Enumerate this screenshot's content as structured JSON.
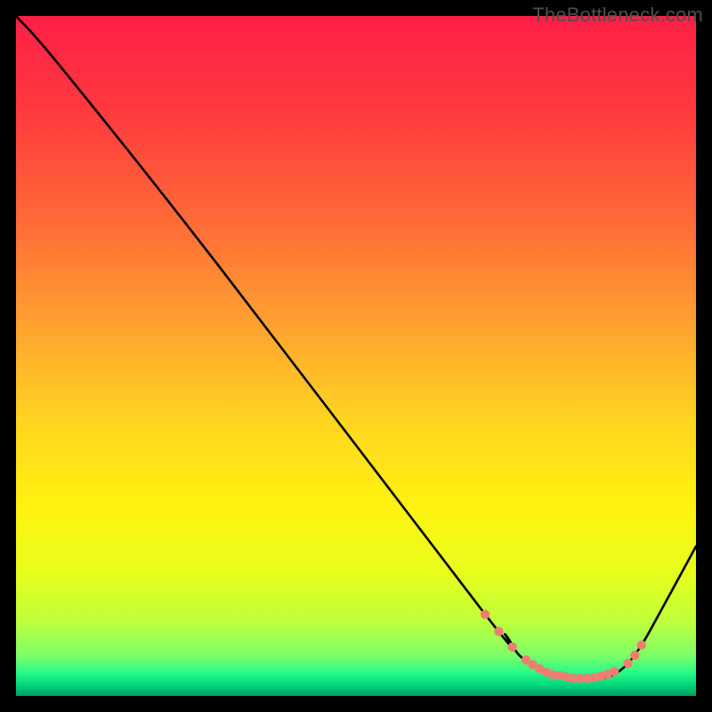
{
  "watermark": "TheBottleneck.com",
  "chart_data": {
    "type": "line",
    "title": "",
    "xlabel": "",
    "ylabel": "",
    "xlim": [
      0,
      100
    ],
    "ylim": [
      0,
      100
    ],
    "grid": false,
    "series": [
      {
        "name": "curve",
        "x": [
          0,
          7,
          30,
          69,
          72,
          74,
          77,
          80,
          82,
          84,
          86,
          88,
          90,
          92,
          94,
          100
        ],
        "y": [
          100,
          92,
          63,
          12,
          9,
          6,
          4,
          3,
          2.5,
          2.5,
          2.6,
          3.2,
          4.8,
          7.5,
          11,
          22
        ]
      }
    ],
    "markers": {
      "name": "highlight-points",
      "color": "#ef7e72",
      "x": [
        69,
        71,
        73,
        75,
        76,
        77,
        78,
        79,
        80,
        81,
        82,
        83,
        84,
        85,
        86,
        87,
        88,
        90,
        91,
        92
      ],
      "y": [
        12,
        9.5,
        7.2,
        5.3,
        4.6,
        4.0,
        3.5,
        3.1,
        3.0,
        2.8,
        2.6,
        2.6,
        2.6,
        2.7,
        2.9,
        3.2,
        3.6,
        4.8,
        6.0,
        7.5
      ]
    },
    "gradient_stops": [
      {
        "offset": 0.0,
        "color": "#ff1f47"
      },
      {
        "offset": 0.14,
        "color": "#ff3a3e"
      },
      {
        "offset": 0.3,
        "color": "#ff6a37"
      },
      {
        "offset": 0.46,
        "color": "#ffa42f"
      },
      {
        "offset": 0.6,
        "color": "#ffd61f"
      },
      {
        "offset": 0.72,
        "color": "#fff210"
      },
      {
        "offset": 0.82,
        "color": "#e6ff1b"
      },
      {
        "offset": 0.89,
        "color": "#bfff3b"
      },
      {
        "offset": 0.94,
        "color": "#7dff66"
      },
      {
        "offset": 0.965,
        "color": "#2bfb87"
      },
      {
        "offset": 0.985,
        "color": "#00d47c"
      },
      {
        "offset": 1.0,
        "color": "#009a5c"
      }
    ]
  }
}
